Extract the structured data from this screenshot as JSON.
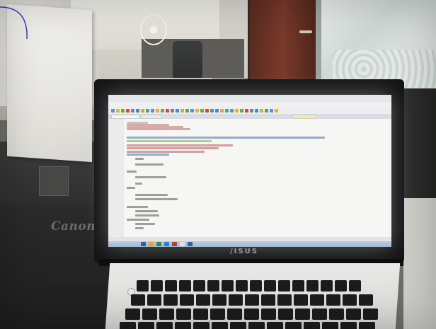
{
  "scene": {
    "description_labels": {
      "printer_brand": "Canon",
      "laptop_brand": "/ISUS"
    },
    "colors": {
      "screen_bg": "#f6f6f4",
      "bezel": "#141415",
      "door": "#7a3a2b",
      "taskbar": "#b9cde2"
    }
  }
}
